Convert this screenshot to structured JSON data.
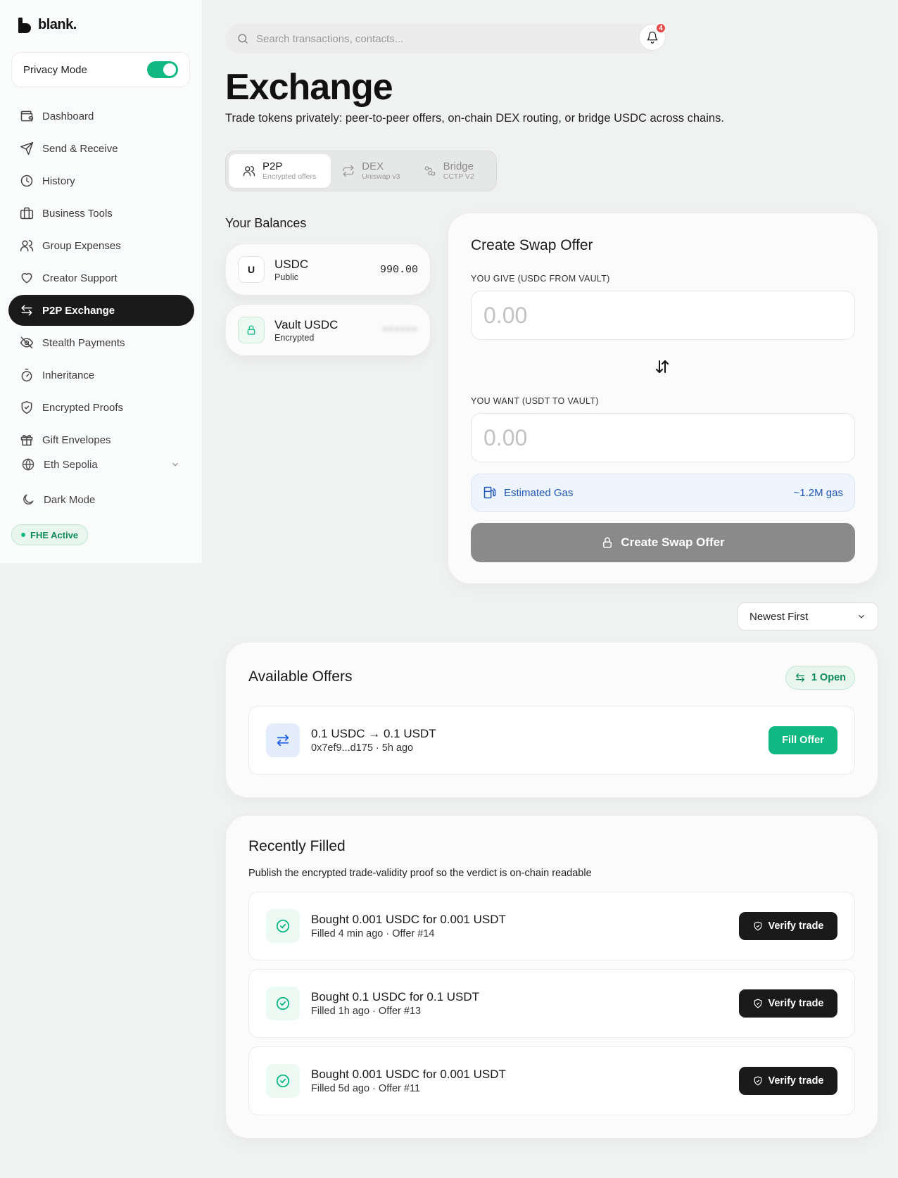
{
  "brand": {
    "name": "blank."
  },
  "sidebar": {
    "privacy_label": "Privacy Mode",
    "privacy_on": true,
    "items": [
      {
        "label": "Dashboard",
        "icon": "wallet-icon"
      },
      {
        "label": "Send & Receive",
        "icon": "send-icon"
      },
      {
        "label": "History",
        "icon": "clock-icon"
      },
      {
        "label": "Business Tools",
        "icon": "briefcase-icon"
      },
      {
        "label": "Group Expenses",
        "icon": "users-icon"
      },
      {
        "label": "Creator Support",
        "icon": "heart-icon"
      },
      {
        "label": "P2P Exchange",
        "icon": "exchange-icon",
        "active": true
      },
      {
        "label": "Stealth Payments",
        "icon": "eye-off-icon"
      },
      {
        "label": "Inheritance",
        "icon": "timer-icon"
      },
      {
        "label": "Encrypted Proofs",
        "icon": "shield-check-icon"
      },
      {
        "label": "Gift Envelopes",
        "icon": "gift-icon"
      }
    ],
    "network": "Eth Sepolia",
    "dark_mode_label": "Dark Mode",
    "fhe_status": "FHE Active"
  },
  "header": {
    "search_placeholder": "Search transactions, contacts...",
    "notification_count": "4"
  },
  "page": {
    "title": "Exchange",
    "subtitle": "Trade tokens privately: peer-to-peer offers, on-chain DEX routing, or bridge USDC across chains."
  },
  "tabs": [
    {
      "label": "P2P",
      "sub": "Encrypted offers",
      "active": true
    },
    {
      "label": "DEX",
      "sub": "Uniswap v3"
    },
    {
      "label": "Bridge",
      "sub": "CCTP V2"
    }
  ],
  "balances": {
    "heading": "Your Balances",
    "items": [
      {
        "avatar": "U",
        "name": "USDC",
        "sub": "Public",
        "value": "990.00"
      },
      {
        "name": "Vault USDC",
        "sub": "Encrypted",
        "value": "••••••"
      }
    ]
  },
  "swap": {
    "title": "Create Swap Offer",
    "give_label": "YOU GIVE (USDC FROM VAULT)",
    "give_placeholder": "0.00",
    "want_label": "YOU WANT (USDT TO VAULT)",
    "want_placeholder": "0.00",
    "gas_label": "Estimated Gas",
    "gas_value": "~1.2M gas",
    "button": "Create Swap Offer"
  },
  "sort": {
    "selected": "Newest First"
  },
  "offers": {
    "title": "Available Offers",
    "open_count": "1 Open",
    "items": [
      {
        "title": "0.1 USDC → 0.1 USDT",
        "sub": "0x7ef9...d175 · 5h ago",
        "action": "Fill Offer"
      }
    ]
  },
  "filled": {
    "title": "Recently Filled",
    "desc": "Publish the encrypted trade-validity proof so the verdict is on-chain readable",
    "items": [
      {
        "title": "Bought 0.001 USDC for 0.001 USDT",
        "sub": "Filled 4 min ago · Offer #14",
        "action": "Verify trade"
      },
      {
        "title": "Bought 0.1 USDC for 0.1 USDT",
        "sub": "Filled 1h ago · Offer #13",
        "action": "Verify trade"
      },
      {
        "title": "Bought 0.001 USDC for 0.001 USDT",
        "sub": "Filled 5d ago · Offer #11",
        "action": "Verify trade"
      }
    ]
  },
  "colors": {
    "accent_green": "#10b981",
    "dark": "#1a1a1a",
    "gas_blue": "#2157b6"
  }
}
